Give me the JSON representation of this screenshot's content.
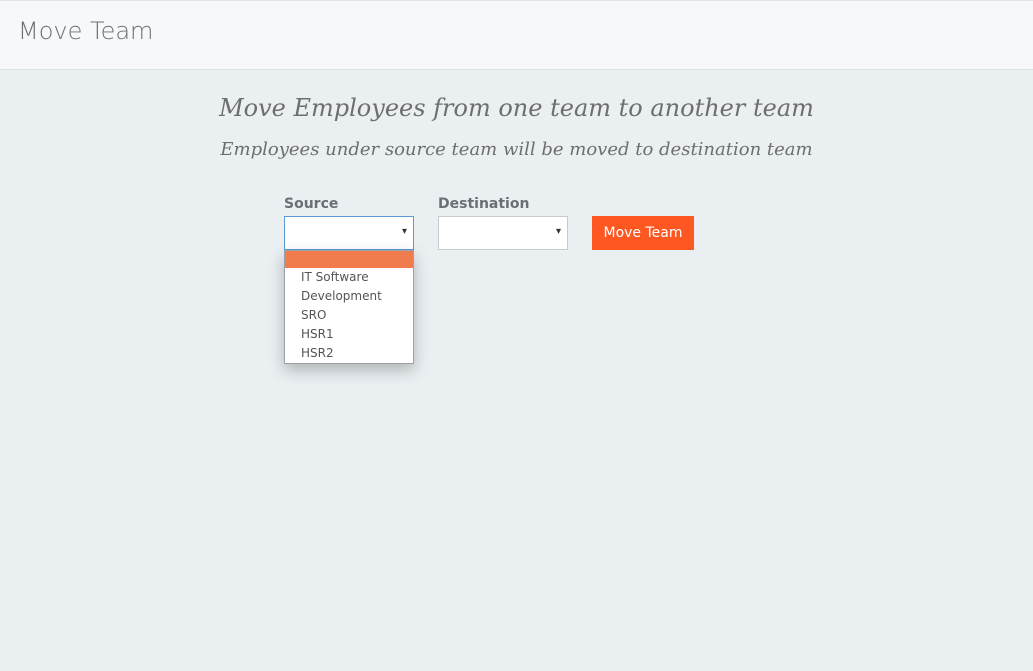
{
  "header": {
    "title": "Move Team"
  },
  "main": {
    "headline": "Move Employees from one team to another team",
    "subheadline": "Employees under source team will be moved to destination team"
  },
  "form": {
    "source": {
      "label": "Source",
      "value": "",
      "options": [
        "",
        "IT Software",
        "Development",
        "SRO",
        "HSR1",
        "HSR2"
      ],
      "highlighted_option": 0
    },
    "destination": {
      "label": "Destination",
      "value": ""
    },
    "submit_label": "Move Team",
    "arrow_glyph": "▾"
  },
  "colors": {
    "accent": "#ff5722",
    "highlight": "#f07b4d",
    "background": "#eaeff2",
    "header_bg": "#f6f8fa"
  },
  "icons": {
    "select_arrow": "chevron-down-icon"
  }
}
